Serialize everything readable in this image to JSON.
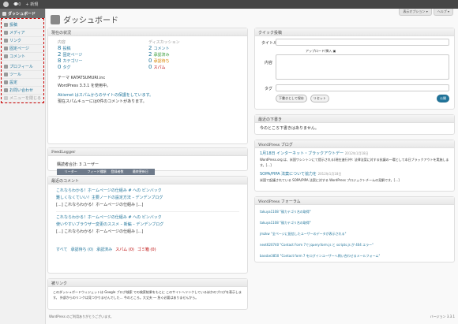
{
  "adminbar": {
    "comments_count": "0",
    "new_label": "+ 新規"
  },
  "sidebar": {
    "dashboard": "ダッシュボード",
    "items": [
      "投稿",
      "メディア",
      "リンク",
      "固定ページ",
      "コメント",
      "プロフィール",
      "ツール",
      "設定",
      "お問い合わせ",
      "メニューを閉じる"
    ]
  },
  "header": {
    "title": "ダッシュボード",
    "screen_options": "表示オプション ▾",
    "help": "ヘルプ ▾"
  },
  "right_now": {
    "title": "現在の状況",
    "content_heading": "内容",
    "discussion_heading": "ディスカッション",
    "content": [
      {
        "count": "8",
        "label": "投稿"
      },
      {
        "count": "2",
        "label": "固定ページ"
      },
      {
        "count": "8",
        "label": "カテゴリー"
      },
      {
        "count": "0",
        "label": "タグ"
      }
    ],
    "discussion": [
      {
        "count": "2",
        "label": "コメント"
      },
      {
        "count": "2",
        "label": "承認済み"
      },
      {
        "count": "0",
        "label": "承認待ち"
      },
      {
        "count": "0",
        "label": "スパム"
      }
    ],
    "theme": "テーマ KATATSUMURI.inc",
    "version": "WordPress 3.3.1 を使用中。",
    "akismet1": "Akismet はスパムからのサイトの保護をしています。",
    "akismet2": "現在スパムキューには0件のコメントがあります。"
  },
  "feedlogger": {
    "title": "FeedLogger",
    "total": "購読者合計: 3 ユーザー",
    "headers": [
      "リーダー",
      "フィード種類",
      "登録者数",
      "最終更新日"
    ],
    "rows": [
      [
        "Google Reader",
        "rdf",
        "2",
        "03/23 04:23:19"
      ],
      [
        "",
        "rss2",
        "1",
        "03/23 17:14:32"
      ]
    ]
  },
  "recent_comments": {
    "title": "最近のコメント",
    "items": [
      {
        "head": "これならわかる！ホームページの仕組み # への ピンバック",
        "link": "難しくなくていい！主要ノードの設定方法 – デンデンブログ",
        "body": "[...] これならわかる！ホームページの仕組み [...]"
      },
      {
        "head": "これならわかる！ホームページの仕組み # への ピンバック",
        "link": "使いやすいブラウザー変更のススメ – 新編 – デンデンブログ",
        "body": "[...] これならわかる！ホームページの仕組み [...]"
      }
    ],
    "footer": [
      "すべて",
      "承認待ち (0)",
      "承認済み",
      "スパム (0)",
      "ゴミ箱 (0)"
    ]
  },
  "incoming_links": {
    "title": "被リンク",
    "text1": "このダッシュボードウィジェットは Google ブログ検索 での検索結果をもとに このサイトへリンクしているほかのブログを表示します。",
    "text2": "外部からのリンクは見つかりませんでした… 今のところ。大丈夫 ― 急ぐ必要はありませんから。"
  },
  "quick_press": {
    "title": "クイック投稿",
    "title_label": "タイトル",
    "upload_label": "アップロード/挿入",
    "content_label": "内容",
    "tags_label": "タグ",
    "save_draft": "下書きとして保存",
    "reset": "リセット",
    "publish": "公開"
  },
  "recent_drafts": {
    "title": "最近の下書き",
    "text": "今のところ下書きはありません。"
  },
  "wp_blog": {
    "title": "WordPress ブログ",
    "items": [
      {
        "link": "1月18日 インターネット・ブラックアウトデー",
        "date": "2012年1月18日",
        "text": "WordPress.org は、米国ワシントンにて提示される(現在進行)中: 法律法案に対する抗議の一環として本日ブラックアウトを実施します。[…]"
      },
      {
        "link": "SOPA/PIPA 法案について協力を",
        "date": "2012年1月18日",
        "text": "米国で起議されている SOPA/PIPA 法案に対する WordPress プロジェクトチームの見解です。[…]"
      }
    ]
  },
  "wp_forum": {
    "title": "WordPress フォーラム",
    "items": [
      {
        "user": "takuya1108",
        "topic": "\"親カテゴリ名の取得\""
      },
      {
        "user": "takuya1108",
        "topic": "\"親カテゴリ名の取得\""
      },
      {
        "user": "jmzkw",
        "topic": "\"全ページに配信したユーザーのデータが表示される\""
      },
      {
        "user": "next620740",
        "topic": "\"Contact Form 7で jquery.form.js と scripts.js が 404 エラー\""
      },
      {
        "user": "bassbe3850",
        "topic": "\"Contact form 7 をログインユーザーへ問い合わせるメールフォーム\""
      }
    ]
  },
  "footer": {
    "left": "WordPress のご利用ありがとうございます。",
    "right": "バージョン 3.3.1"
  }
}
